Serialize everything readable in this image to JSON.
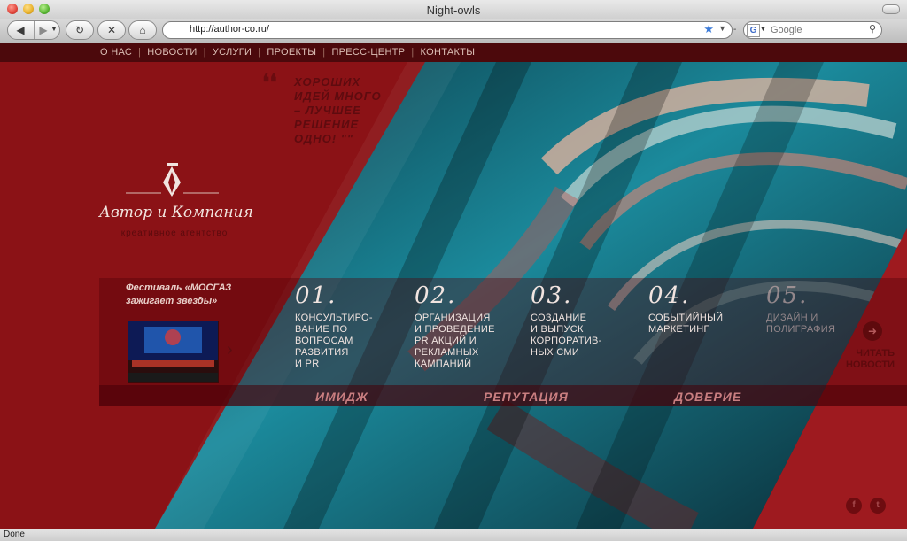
{
  "window": {
    "title": "Night-owls"
  },
  "toolbar": {
    "url": "http://author-co.ru/",
    "search_placeholder": "Google",
    "search_engine_letter": "G"
  },
  "nav": {
    "items": [
      "О НАС",
      "НОВОСТИ",
      "УСЛУГИ",
      "ПРОЕКТЫ",
      "ПРЕСС-ЦЕНТР",
      "КОНТАКТЫ"
    ],
    "separator": "|"
  },
  "quote": {
    "marks": "❛❛",
    "text": "ХОРОШИХ ИДЕЙ МНОГО – ЛУЧШЕЕ РЕШЕНИЕ ОДНО! \"\""
  },
  "logo": {
    "name": "Автор и Компания",
    "tagline": "креативное агентство"
  },
  "festival": {
    "title": "Фестиваль «МОСГАЗ зажигает звезды»"
  },
  "services": [
    {
      "num": "01.",
      "lines": [
        "КОНСУЛЬТИРО-",
        "ВАНИЕ ПО",
        "ВОПРОСАМ",
        "РАЗВИТИЯ",
        "И PR"
      ]
    },
    {
      "num": "02.",
      "lines": [
        "ОРГАНИЗАЦИЯ",
        "И ПРОВЕДЕНИЕ",
        "PR АКЦИЙ И",
        "РЕКЛАМНЫХ",
        "КАМПАНИЙ"
      ]
    },
    {
      "num": "03.",
      "lines": [
        "СОЗДАНИЕ",
        "И ВЫПУСК",
        "КОРПОРАТИВ-",
        "НЫХ СМИ"
      ]
    },
    {
      "num": "04.",
      "lines": [
        "СОБЫТИЙНЫЙ",
        "МАРКЕТИНГ"
      ]
    },
    {
      "num": "05.",
      "lines": [
        "ДИЗАЙН И",
        "ПОЛИГРАФИЯ"
      ]
    }
  ],
  "values": [
    "ИМИДЖ",
    "РЕПУТАЦИЯ",
    "ДОВЕРИЕ"
  ],
  "read_news": {
    "line1": "ЧИТАТЬ",
    "line2": "НОВОСТИ"
  },
  "social": [
    "f",
    "t"
  ],
  "status": {
    "text": "Done"
  },
  "colors": {
    "page_red": "#8b1216",
    "accent_dark": "#5e0a0d",
    "text_light": "#f1e4e0"
  }
}
